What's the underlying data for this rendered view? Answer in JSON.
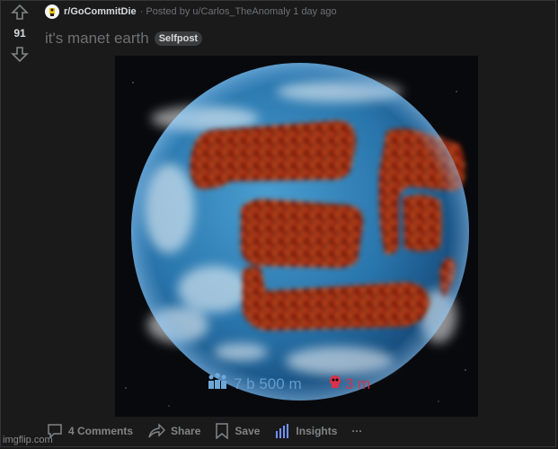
{
  "post": {
    "score": "91",
    "subreddit": "r/GoCommitDie",
    "posted_by": "· Posted by u/Carlos_TheAnomaly 1 day ago",
    "title": "it's manet earth",
    "flair": "Selfpost"
  },
  "image_overlay": {
    "population": "7 b 500 m",
    "deaths": "3 m"
  },
  "actions": {
    "comments": "4 Comments",
    "share": "Share",
    "save": "Save",
    "insights": "Insights",
    "more": "···"
  },
  "watermark": "imgflip.com",
  "colors": {
    "background": "#1a1a1b",
    "text": "#d7dadc",
    "muted": "#818384",
    "insights_accent": "#7193ff"
  },
  "icons": [
    "upvote-arrow-icon",
    "downvote-arrow-icon",
    "subreddit-icon",
    "comment-icon",
    "share-icon",
    "bookmark-icon",
    "insights-bars-icon",
    "population-icon",
    "skull-icon"
  ]
}
